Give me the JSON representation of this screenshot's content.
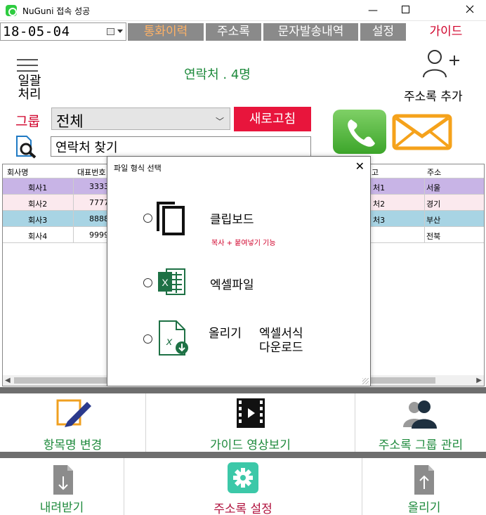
{
  "window": {
    "title": "NuGuni 접속 성공",
    "minimize": "—",
    "maximize": "☐",
    "close": "✕"
  },
  "date": {
    "value": "18-05-04"
  },
  "nav": {
    "tabs": [
      "통화이력",
      "주소록",
      "문자발송내역",
      "설정"
    ],
    "guide": "가이드"
  },
  "header": {
    "batch_label_line1": "일괄",
    "batch_label_line2": "처리",
    "contact_count": "연락처 . 4명",
    "add_contact_label": "주소록 추가"
  },
  "group": {
    "label": "그룹",
    "selected": "전체",
    "refresh_label": "새로고침"
  },
  "search": {
    "value": "연락처 찾기"
  },
  "table": {
    "headers": [
      "회사명",
      "대표번호",
      "고",
      "주소"
    ],
    "rows": [
      {
        "company": "회사1",
        "phone": "3333",
        "name": "처1",
        "addr": "서울",
        "color": "#c8b4e6"
      },
      {
        "company": "회사2",
        "phone": "7777",
        "name": "처2",
        "addr": "경기",
        "color": "#fbe9ee"
      },
      {
        "company": "회사3",
        "phone": "8888",
        "name": "처3",
        "addr": "부산",
        "color": "#a8d4e4"
      },
      {
        "company": "회사4",
        "phone": "9999",
        "name": "",
        "addr": "전북",
        "color": "#ffffff"
      }
    ]
  },
  "dialog": {
    "title": "파일 형식 선택",
    "close": "✕",
    "options": {
      "clipboard": {
        "label": "클립보드",
        "sub": "복사 + 붙여넣기 기능"
      },
      "excel": {
        "label": "엑셀파일"
      },
      "upload": {
        "label_a": "올리기",
        "label_b": "엑셀서식",
        "label_c": "다운로드"
      }
    }
  },
  "tools_top": {
    "rename": "항목명 변경",
    "guide_video": "가이드 영상보기",
    "group_manage": "주소록 그룹 관리"
  },
  "tools_bottom": {
    "download": "내려받기",
    "settings": "주소록 설정",
    "upload": "올리기"
  },
  "colors": {
    "accent_green": "#1e8a3c",
    "accent_red": "#d0002a",
    "settings_teal": "#3cc8a8"
  }
}
